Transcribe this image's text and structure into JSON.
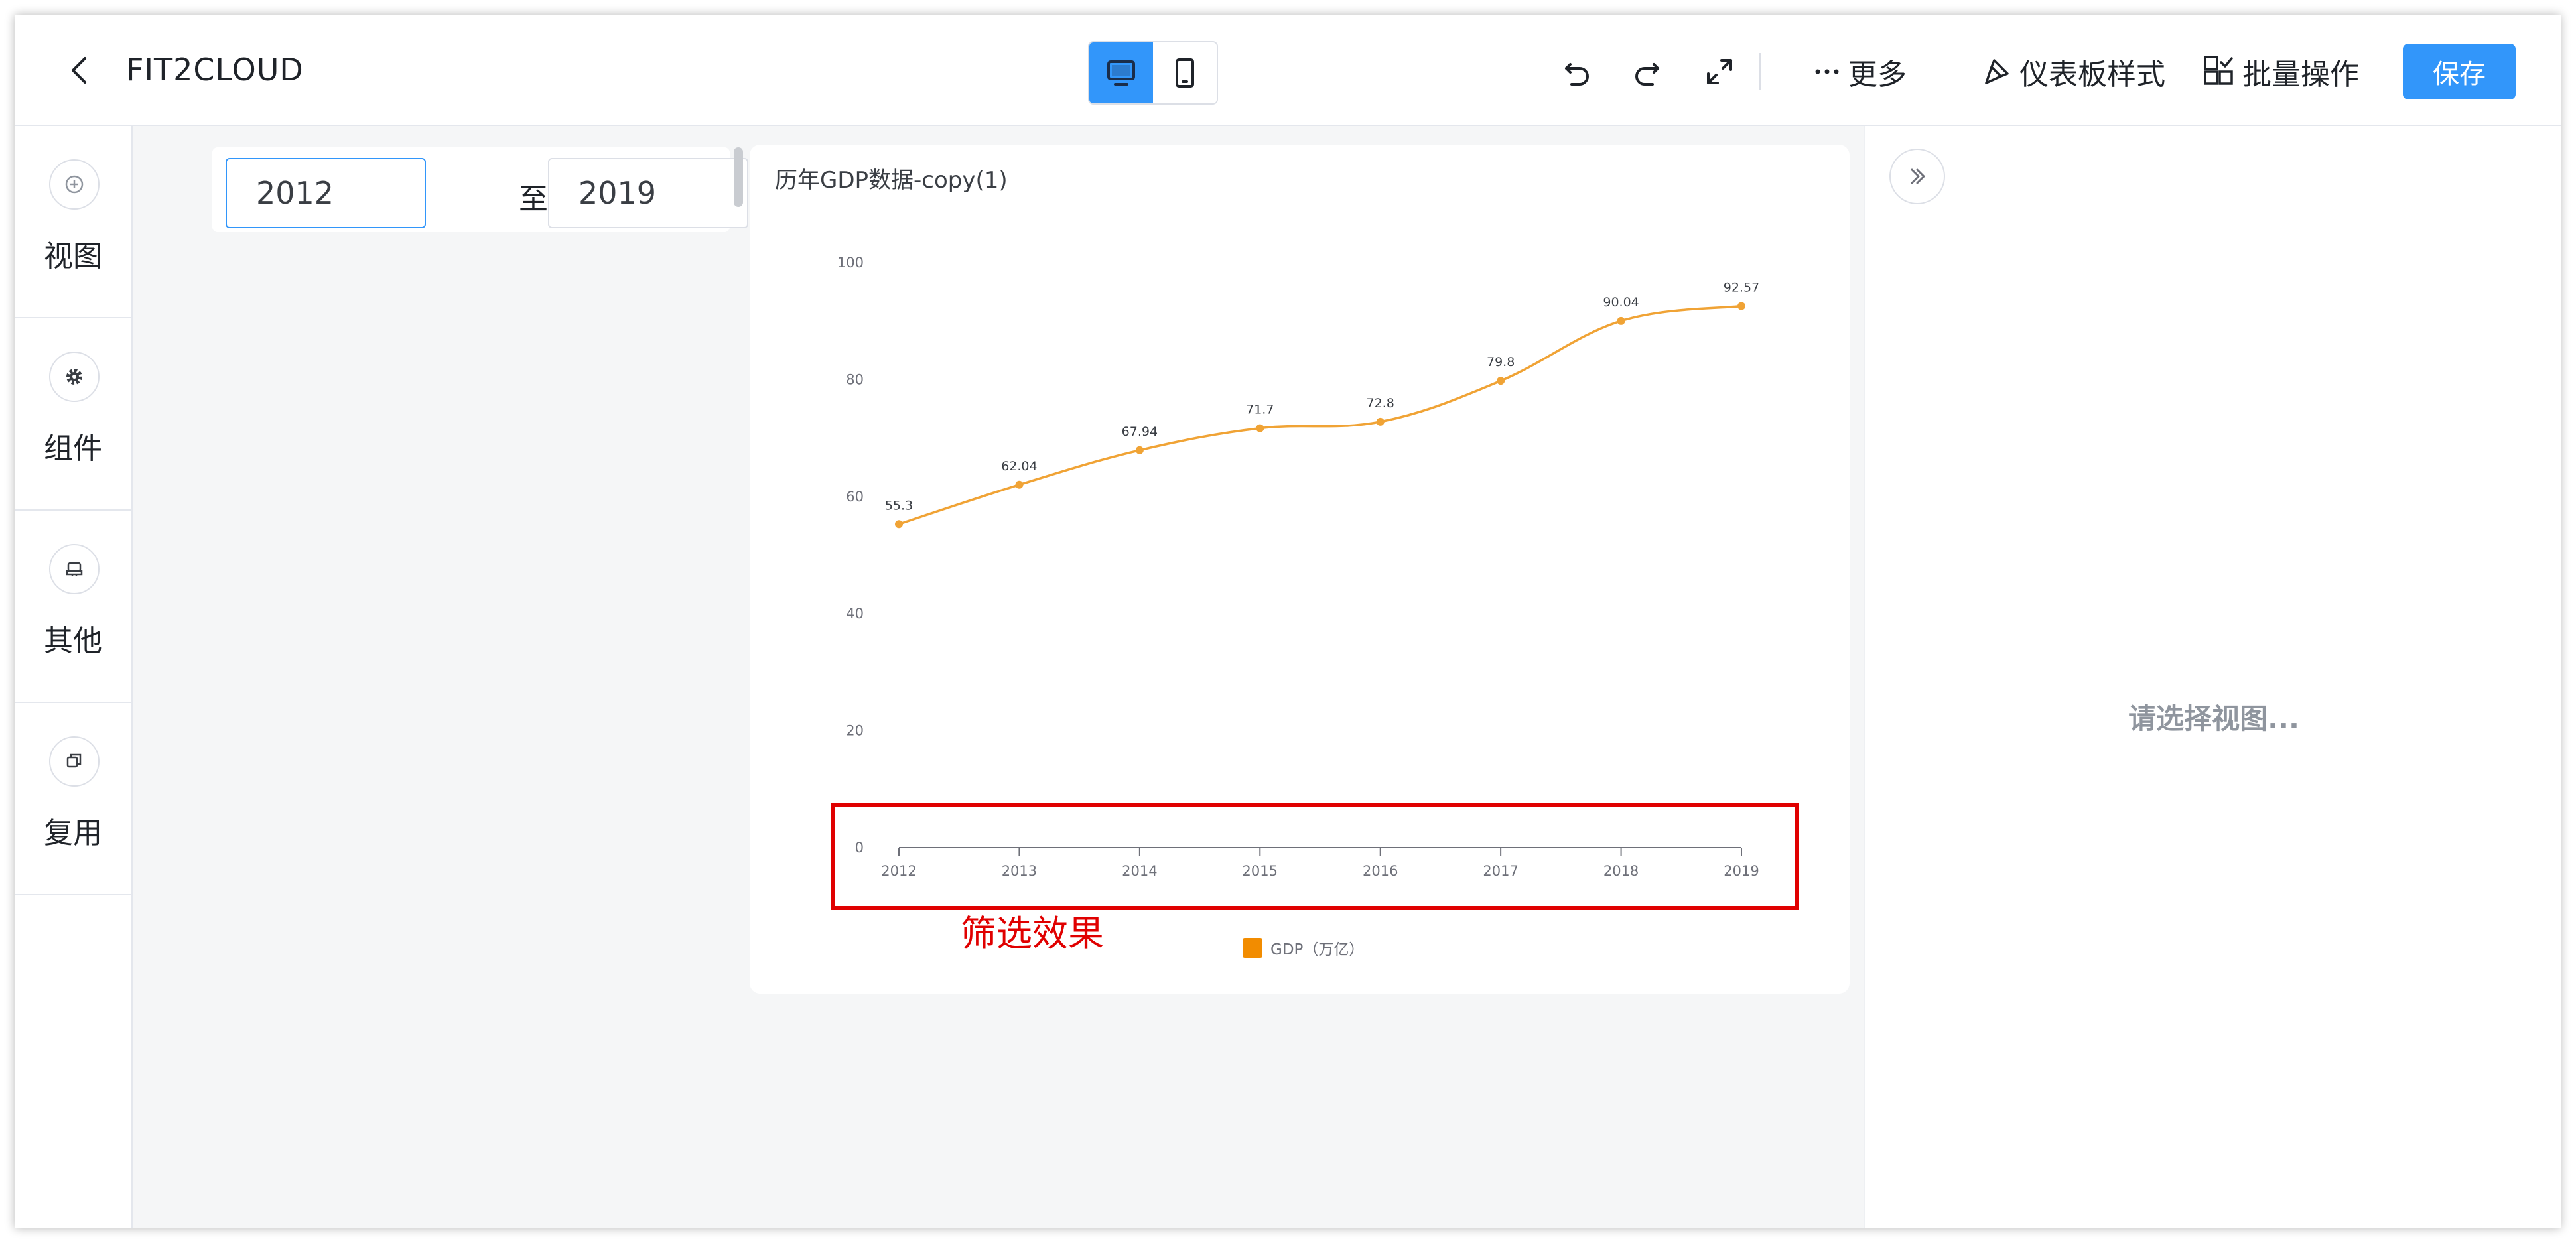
{
  "header": {
    "title": "FIT2CLOUD",
    "more_label": "更多",
    "style_label": "仪表板样式",
    "batch_label": "批量操作",
    "save_label": "保存"
  },
  "sidebar": {
    "items": [
      {
        "label": "视图",
        "icon": "plus-circle-icon"
      },
      {
        "label": "组件",
        "icon": "gear-icon"
      },
      {
        "label": "其他",
        "icon": "stamp-icon"
      },
      {
        "label": "复用",
        "icon": "copy-icon"
      }
    ]
  },
  "filter": {
    "start": "2012",
    "separator": "至",
    "end": "2019"
  },
  "chart_data": {
    "type": "line",
    "title": "历年GDP数据-copy(1)",
    "categories": [
      "2012",
      "2013",
      "2014",
      "2015",
      "2016",
      "2017",
      "2018",
      "2019"
    ],
    "series": [
      {
        "name": "GDP（万亿）",
        "values": [
          55.3,
          62.04,
          67.94,
          71.7,
          72.8,
          79.8,
          90.04,
          92.57
        ],
        "color": "#f0a335"
      }
    ],
    "y_ticks": [
      0,
      20,
      40,
      60,
      80,
      100
    ],
    "ylim": [
      0,
      100
    ],
    "smooth": true,
    "legend_position": "bottom",
    "legend_color": "#f28c00"
  },
  "annotation": {
    "text": "筛选效果",
    "color": "#e00000"
  },
  "right_panel": {
    "hint": "请选择视图..."
  },
  "colors": {
    "accent": "#3296fa",
    "annotation": "#e00000"
  }
}
